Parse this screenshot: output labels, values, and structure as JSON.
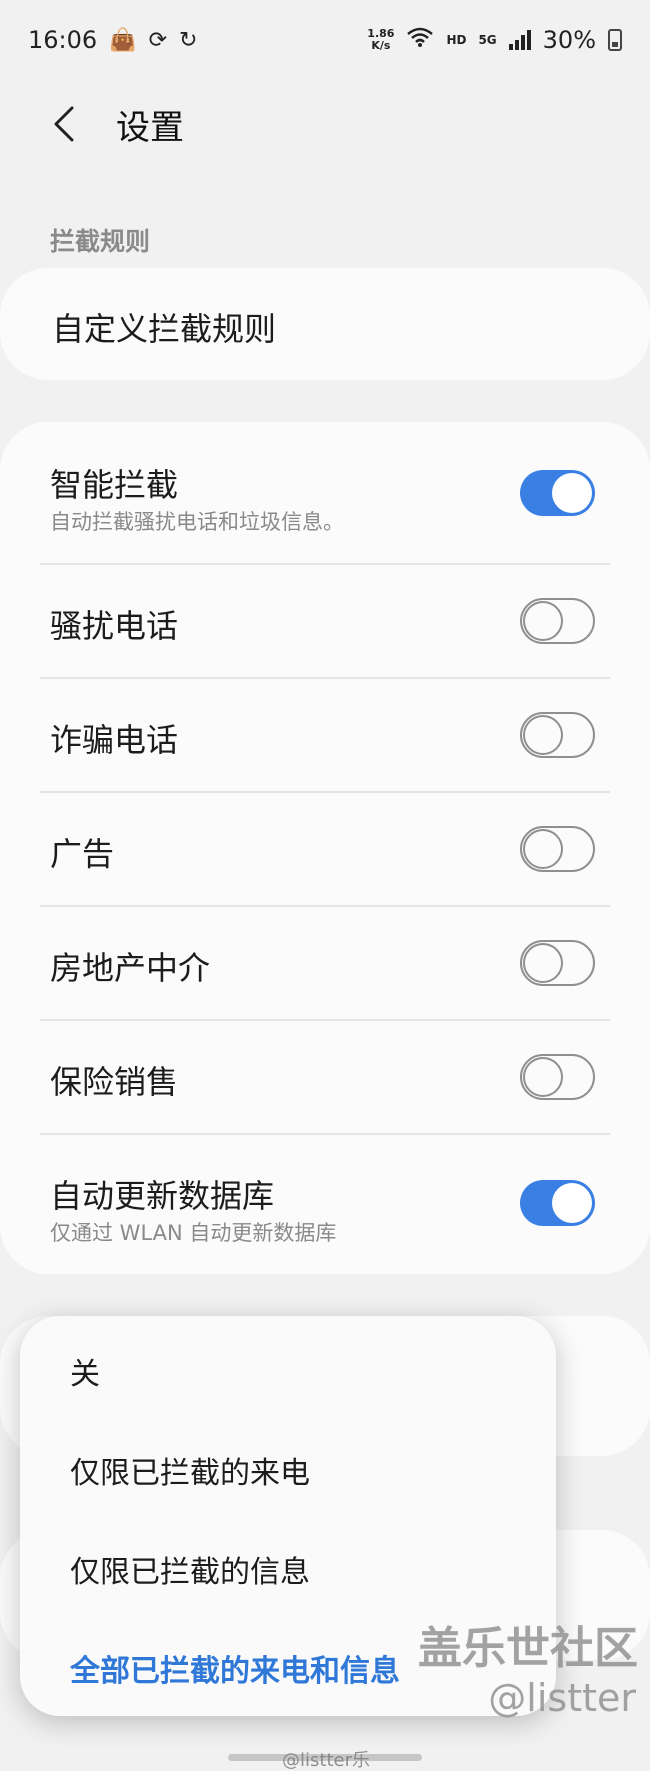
{
  "status_bar": {
    "time": "16:06",
    "net_speed_value": "1.86",
    "net_speed_unit": "K/s",
    "hd_label": "HD",
    "network_label": "5G",
    "battery": "30%"
  },
  "header": {
    "title": "设置"
  },
  "section": {
    "label": "拦截规则"
  },
  "custom_rules": {
    "label": "自定义拦截规则"
  },
  "rules": [
    {
      "title": "智能拦截",
      "subtitle": "自动拦截骚扰电话和垃圾信息。",
      "enabled": true
    },
    {
      "title": "骚扰电话",
      "enabled": false
    },
    {
      "title": "诈骗电话",
      "enabled": false
    },
    {
      "title": "广告",
      "enabled": false
    },
    {
      "title": "房地产中介",
      "enabled": false
    },
    {
      "title": "保险销售",
      "enabled": false
    },
    {
      "title": "自动更新数据库",
      "subtitle": "仅通过 WLAN 自动更新数据库",
      "enabled": true
    }
  ],
  "popup": {
    "options": [
      "关",
      "仅限已拦截的来电",
      "仅限已拦截的信息",
      "全部已拦截的来电和信息"
    ],
    "selected_index": 3
  },
  "watermark": {
    "site": "盖乐世社区",
    "user": "@listter",
    "bottom": "@listter乐"
  },
  "colors": {
    "accent": "#3a7fe3",
    "selected_text": "#2f78d8",
    "background": "#f1f1f1",
    "card": "#fbfbfb"
  }
}
